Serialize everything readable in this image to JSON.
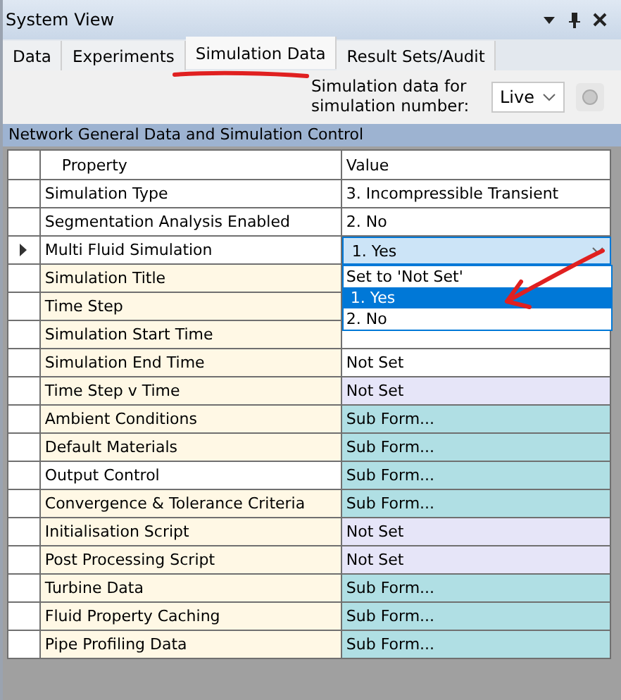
{
  "window": {
    "title": "System View"
  },
  "tabs": [
    {
      "label": "Data",
      "selected": false
    },
    {
      "label": "Experiments",
      "selected": false
    },
    {
      "label": "Simulation Data",
      "selected": true
    },
    {
      "label": "Result Sets/Audit",
      "selected": false
    }
  ],
  "simulation_selector": {
    "label": "Simulation data for simulation number:",
    "value": "Live"
  },
  "section": {
    "title": "Network General Data and Simulation Control"
  },
  "table": {
    "columns": [
      "Property",
      "Value"
    ],
    "rows": [
      {
        "property": "Simulation Type",
        "value": "3. Incompressible Transient",
        "kind": "plain",
        "shaded": false,
        "selected": false
      },
      {
        "property": "Segmentation Analysis Enabled",
        "value": "2. No",
        "kind": "plain",
        "shaded": false,
        "selected": false
      },
      {
        "property": "Multi Fluid Simulation",
        "value": "1. Yes",
        "kind": "combo",
        "shaded": false,
        "selected": true
      },
      {
        "property": "Simulation Title",
        "kind": "plain",
        "shaded": true,
        "selected": false
      },
      {
        "property": "Time Step",
        "kind": "plain",
        "shaded": true,
        "selected": false
      },
      {
        "property": "Simulation Start Time",
        "kind": "plain",
        "shaded": true,
        "selected": false
      },
      {
        "property": "Simulation End Time",
        "value": "Not Set",
        "kind": "plain",
        "shaded": true,
        "selected": false
      },
      {
        "property": "Time Step v Time",
        "value": "Not Set",
        "kind": "notset",
        "shaded": true,
        "selected": false
      },
      {
        "property": "Ambient Conditions",
        "value": "Sub Form...",
        "kind": "subform",
        "shaded": true,
        "selected": false
      },
      {
        "property": "Default Materials",
        "value": "Sub Form...",
        "kind": "subform",
        "shaded": true,
        "selected": false
      },
      {
        "property": "Output Control",
        "value": "Sub Form...",
        "kind": "subform",
        "shaded": false,
        "selected": false
      },
      {
        "property": "Convergence & Tolerance Criteria",
        "value": "Sub Form...",
        "kind": "subform",
        "shaded": true,
        "selected": false
      },
      {
        "property": "Initialisation Script",
        "value": "Not Set",
        "kind": "notset",
        "shaded": true,
        "selected": false
      },
      {
        "property": "Post Processing Script",
        "value": "Not Set",
        "kind": "notset",
        "shaded": true,
        "selected": false
      },
      {
        "property": "Turbine Data",
        "value": "Sub Form...",
        "kind": "subform",
        "shaded": true,
        "selected": false
      },
      {
        "property": "Fluid Property Caching",
        "value": "Sub Form...",
        "kind": "subform",
        "shaded": true,
        "selected": false
      },
      {
        "property": "Pipe Profiling Data",
        "value": "Sub Form...",
        "kind": "subform",
        "shaded": true,
        "selected": false
      }
    ]
  },
  "dropdown": {
    "options": [
      {
        "label": "Set to 'Not Set'",
        "selected": false
      },
      {
        "label": "1. Yes",
        "selected": true
      },
      {
        "label": "2. No",
        "selected": false
      }
    ]
  }
}
